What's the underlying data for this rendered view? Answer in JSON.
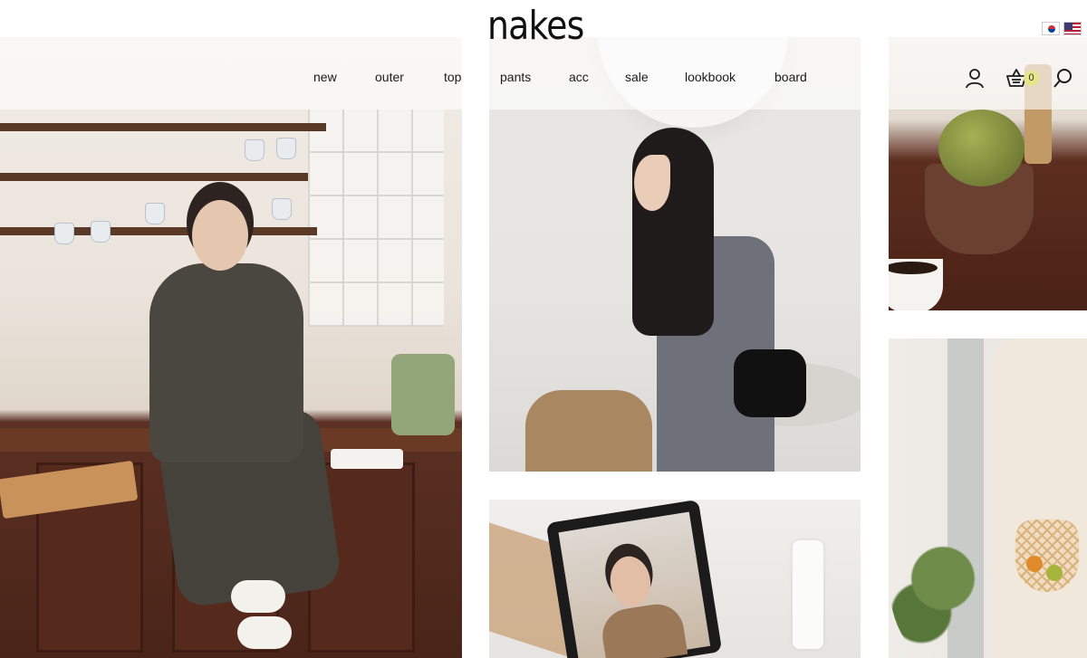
{
  "brand": {
    "logo_text": "nakes"
  },
  "language_switcher": {
    "options": [
      {
        "name": "korean",
        "icon": "kr-flag-icon"
      },
      {
        "name": "english",
        "icon": "us-flag-icon"
      }
    ]
  },
  "nav": {
    "items": [
      {
        "label": "new"
      },
      {
        "label": "outer"
      },
      {
        "label": "top"
      },
      {
        "label": "pants"
      },
      {
        "label": "acc"
      },
      {
        "label": "sale"
      },
      {
        "label": "lookbook"
      },
      {
        "label": "board"
      }
    ]
  },
  "utility": {
    "account_icon": "user-icon",
    "cart_icon": "basket-icon",
    "cart_count": "0",
    "search_icon": "search-icon",
    "cart_badge_color": "#e6e58a"
  },
  "gallery": {
    "tiles": [
      {
        "name": "lookbook-photo-kitchen"
      },
      {
        "name": "lookbook-photo-bag"
      },
      {
        "name": "lookbook-photo-laptop"
      },
      {
        "name": "lookbook-photo-cactus"
      },
      {
        "name": "lookbook-photo-netbag"
      }
    ]
  }
}
